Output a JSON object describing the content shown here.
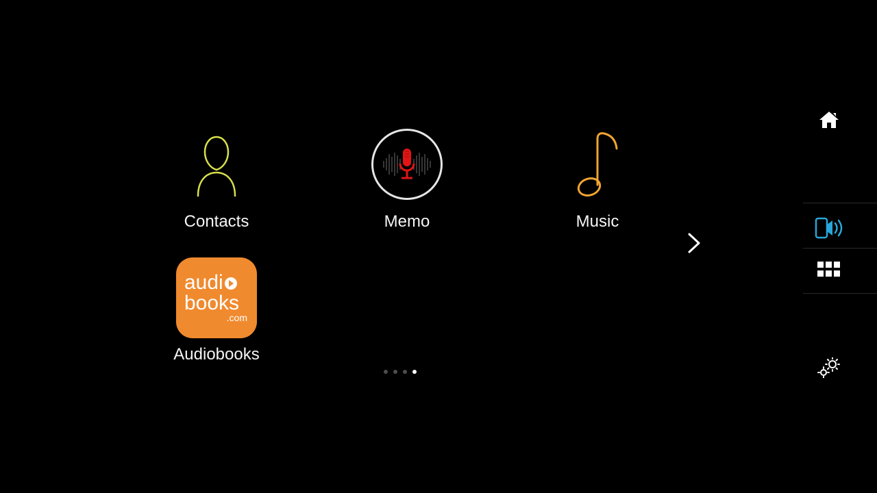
{
  "apps": {
    "contacts": {
      "label": "Contacts"
    },
    "memo": {
      "label": "Memo"
    },
    "music": {
      "label": "Music"
    },
    "audiobooks": {
      "label": "Audiobooks",
      "tile_line1": "audi",
      "tile_line2": "books",
      "tile_line3": ".com"
    }
  },
  "pagination": {
    "total": 4,
    "active_index": 3
  },
  "colors": {
    "accent_orange": "#f08a2e",
    "contacts_outline": "#d7e04a",
    "music_note": "#f2a531",
    "active_side_icon": "#29a6d9",
    "mic_red": "#e11515"
  }
}
